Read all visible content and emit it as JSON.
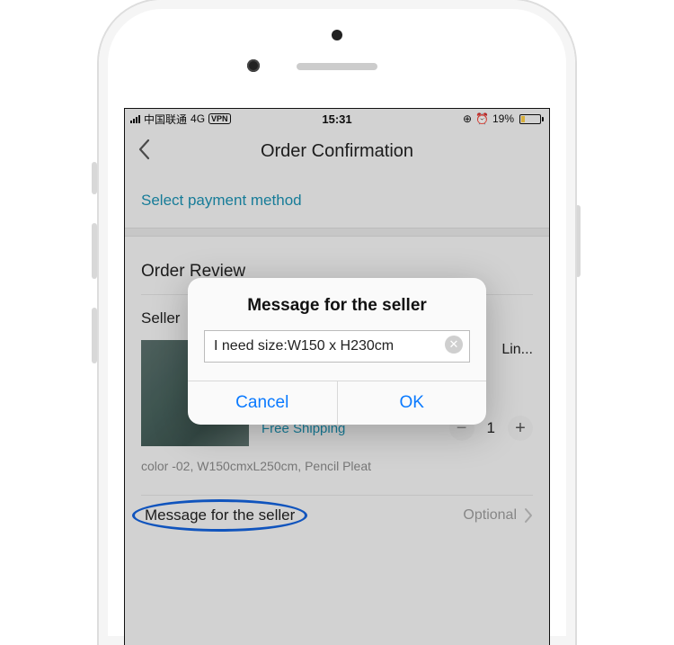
{
  "status": {
    "carrier": "中国联通",
    "network": "4G",
    "vpn": "VPN",
    "time": "15:31",
    "battery_pct": "19%"
  },
  "header": {
    "title": "Order Confirmation"
  },
  "payment_link": "Select payment method",
  "review": {
    "section_title": "Order Review",
    "seller_label": "Seller",
    "product": {
      "title_fragment": "Lin...",
      "shipping": "Free Shipping",
      "quantity": "1",
      "variant": "color -02, W150cmxL250cm, Pencil Pleat"
    },
    "message_row": {
      "label": "Message for the seller",
      "hint": "Optional"
    }
  },
  "dialog": {
    "title": "Message for the seller",
    "input_value": "I need size:W150 x H230cm",
    "cancel": "Cancel",
    "ok": "OK"
  }
}
